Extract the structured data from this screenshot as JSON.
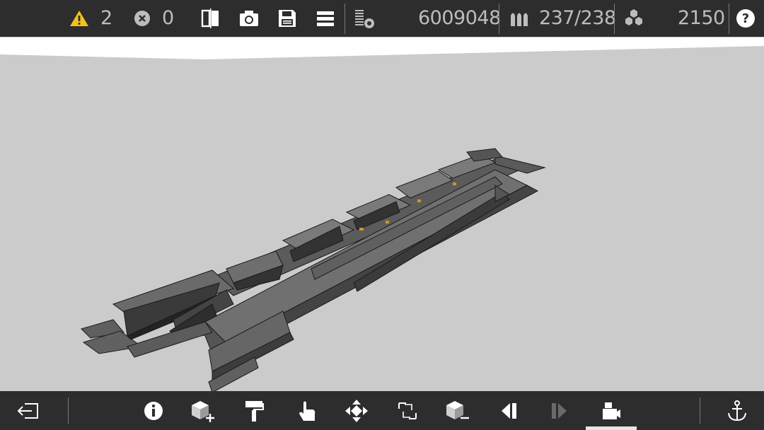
{
  "top_bar": {
    "warnings_count": "2",
    "errors_count": "0",
    "cost": "6009048",
    "ammo": "237/238",
    "blocks": "2150",
    "help_label": "?"
  },
  "icons": {
    "warning": "warning-triangle-icon",
    "error": "error-circle-icon",
    "mirror": "mirror-icon",
    "screenshot": "camera-icon",
    "save": "save-icon",
    "menu": "menu-icon",
    "stats": "stats-icon",
    "ammo": "ammo-icon",
    "blocks": "cubes-icon",
    "help": "help-icon",
    "exit": "exit-icon",
    "info": "info-icon",
    "add_block": "add-block-icon",
    "paint": "paint-roller-icon",
    "select": "hand-pointer-icon",
    "move": "move-icon",
    "resize": "resize-icon",
    "remove_block": "remove-block-icon",
    "prev": "prev-icon",
    "next": "next-icon",
    "camera_view": "camera-view-icon",
    "anchor": "anchor-icon"
  },
  "colors": {
    "bar_bg": "#2d2d2d",
    "viewport_bg": "#cbcbcb",
    "warning": "#f2c21b",
    "text": "#bdbdbd"
  }
}
